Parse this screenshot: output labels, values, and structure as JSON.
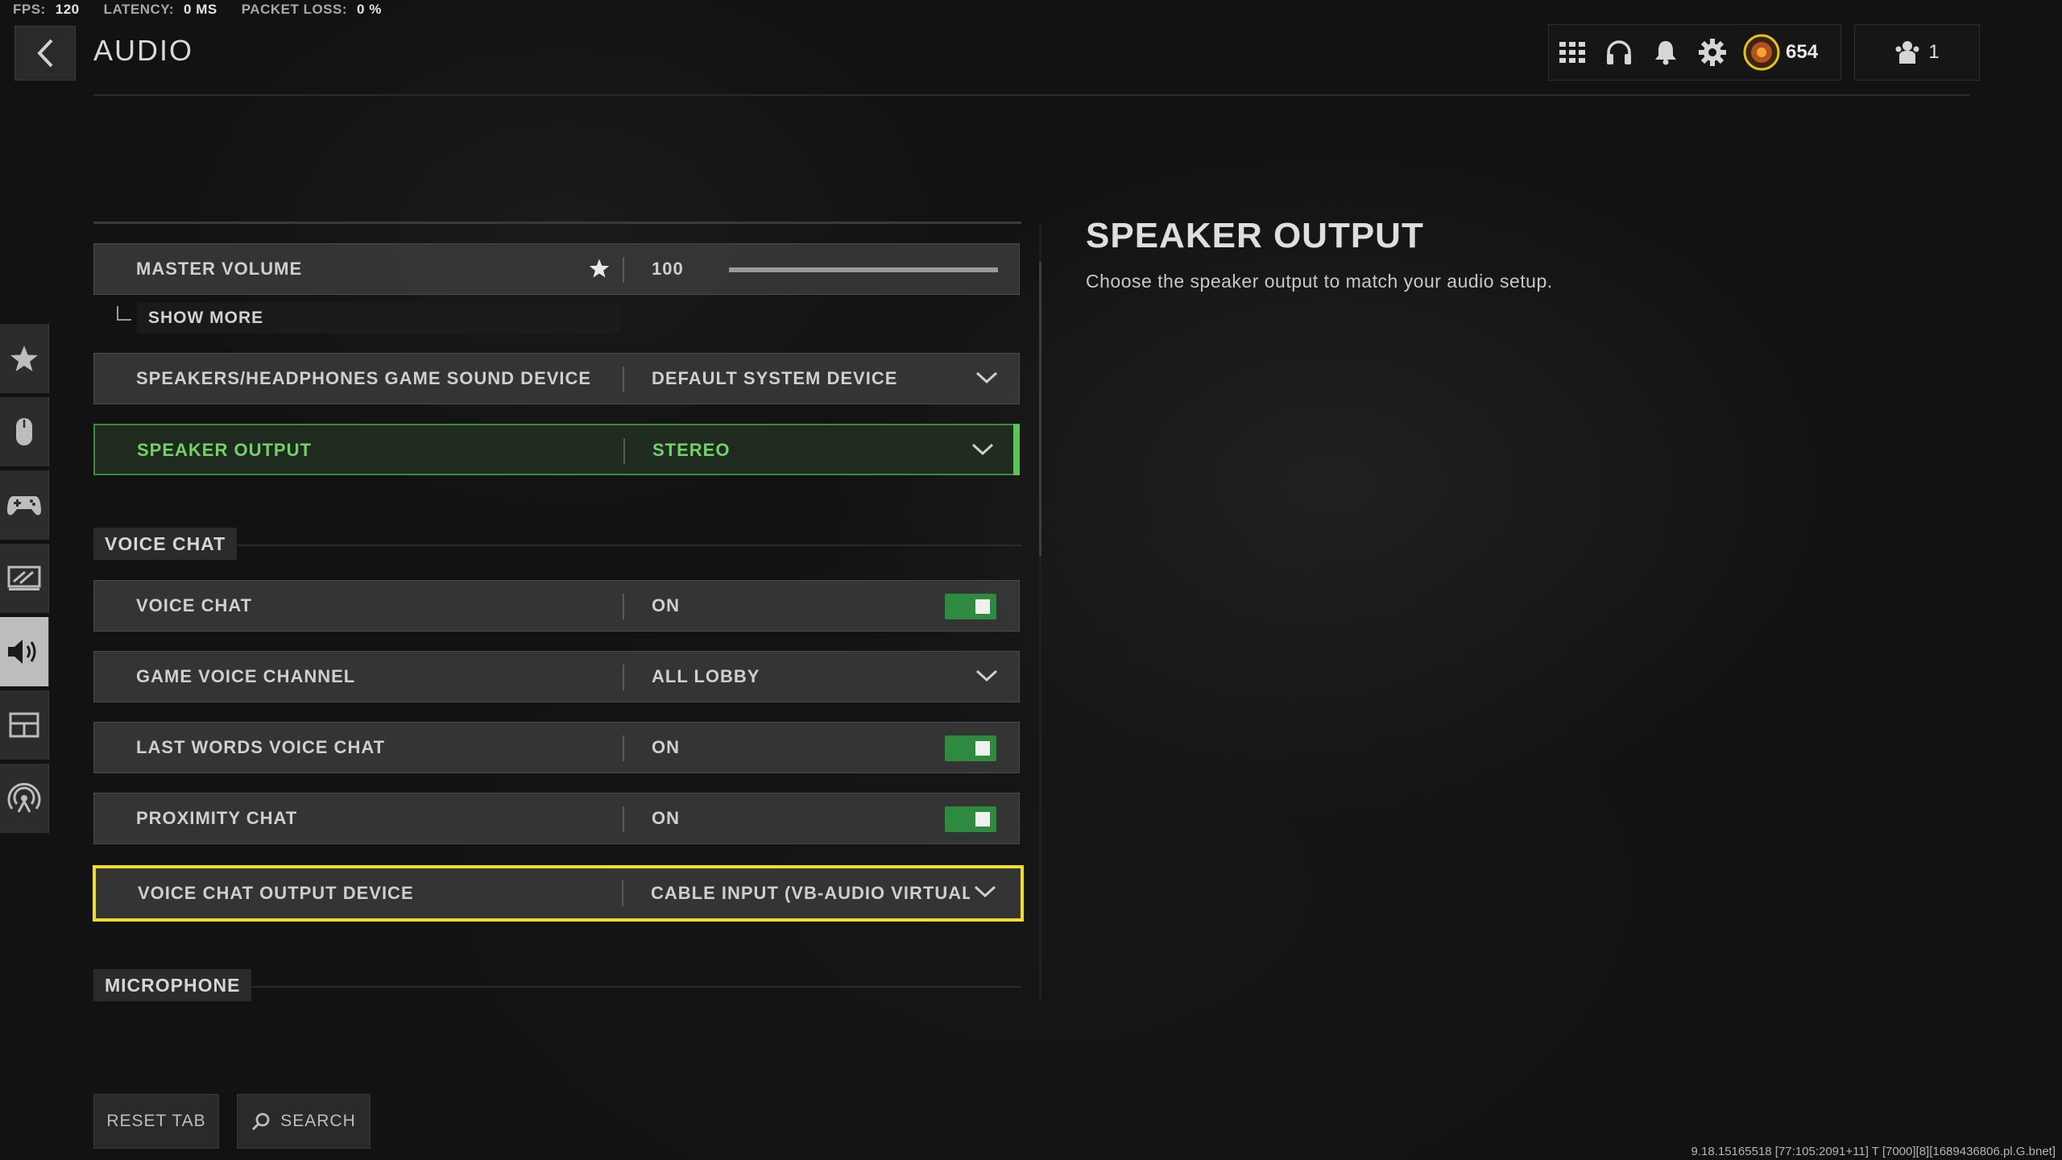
{
  "perf": {
    "fps_label": "FPS:",
    "fps_value": "120",
    "latency_label": "LATENCY:",
    "latency_value": "0 MS",
    "packet_label": "PACKET LOSS:",
    "packet_value": "0 %"
  },
  "header": {
    "title": "AUDIO",
    "cp_value": "654",
    "party_count": "1"
  },
  "rail": {
    "tabs": [
      "star-icon",
      "mouse-icon",
      "controller-icon",
      "display-icon",
      "speaker-icon",
      "interface-icon",
      "network-icon"
    ],
    "active": "speaker-icon"
  },
  "settings": {
    "master_volume": {
      "label": "MASTER VOLUME",
      "value": "100",
      "level": 1.0
    },
    "show_more": "SHOW MORE",
    "sound_device": {
      "label": "SPEAKERS/HEADPHONES GAME SOUND DEVICE",
      "value": "DEFAULT SYSTEM DEVICE"
    },
    "speaker_output": {
      "label": "SPEAKER OUTPUT",
      "value": "STEREO"
    },
    "voice_chat_section": "VOICE CHAT",
    "voice_chat": {
      "label": "VOICE CHAT",
      "value": "ON"
    },
    "game_voice_channel": {
      "label": "GAME VOICE CHANNEL",
      "value": "ALL LOBBY"
    },
    "last_words": {
      "label": "LAST WORDS VOICE CHAT",
      "value": "ON"
    },
    "proximity_chat": {
      "label": "PROXIMITY CHAT",
      "value": "ON"
    },
    "vc_output_device": {
      "label": "VOICE CHAT OUTPUT DEVICE",
      "value": "CABLE INPUT (VB-AUDIO VIRTUAL CABI"
    },
    "microphone_section": "MICROPHONE"
  },
  "detail": {
    "title": "SPEAKER OUTPUT",
    "description": "Choose the speaker output to match your audio setup."
  },
  "buttons": {
    "reset_tab": "RESET TAB",
    "search": "SEARCH"
  },
  "build_info": "9.18.15165518 [77:105:2091+11] T [7000][8][1689436806.pl.G.bnet]",
  "colors": {
    "accent_green": "#5bc35a",
    "toggle_green": "#2e8a3e",
    "focus_yellow": "#f0de2a"
  }
}
